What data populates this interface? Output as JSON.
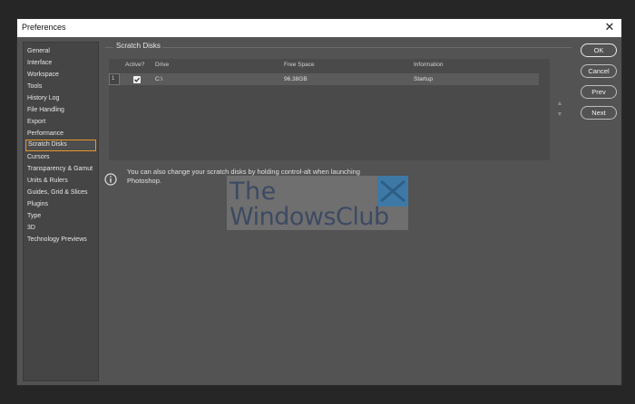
{
  "window": {
    "title": "Preferences",
    "close_symbol": "✕"
  },
  "sidebar": {
    "items": [
      {
        "label": "General"
      },
      {
        "label": "Interface"
      },
      {
        "label": "Workspace"
      },
      {
        "label": "Tools"
      },
      {
        "label": "History Log"
      },
      {
        "label": "File Handling"
      },
      {
        "label": "Export"
      },
      {
        "label": "Performance"
      },
      {
        "label": "Scratch Disks",
        "selected": true
      },
      {
        "label": "Cursors"
      },
      {
        "label": "Transparency & Gamut"
      },
      {
        "label": "Units & Rulers"
      },
      {
        "label": "Guides, Grid & Slices"
      },
      {
        "label": "Plugins"
      },
      {
        "label": "Type"
      },
      {
        "label": "3D"
      },
      {
        "label": "Technology Previews"
      }
    ]
  },
  "scratch": {
    "group_title": "Scratch Disks",
    "columns": {
      "active": "Active?",
      "drive": "Drive",
      "free_space": "Free Space",
      "information": "Information"
    },
    "rows": [
      {
        "num": "1",
        "active": true,
        "drive": "C:\\",
        "free_space": "96.38GB",
        "information": "Startup"
      }
    ],
    "up_arrow": "▲",
    "down_arrow": "▼"
  },
  "info": {
    "text": "You can also change your scratch disks by holding control-alt when launching Photoshop."
  },
  "buttons": {
    "ok": "OK",
    "cancel": "Cancel",
    "prev": "Prev",
    "next": "Next"
  },
  "watermark": {
    "line1": "The",
    "line2": "WindowsClub"
  },
  "colors": {
    "selection_outline": "#e8952c",
    "dialog_bg": "#535353"
  }
}
